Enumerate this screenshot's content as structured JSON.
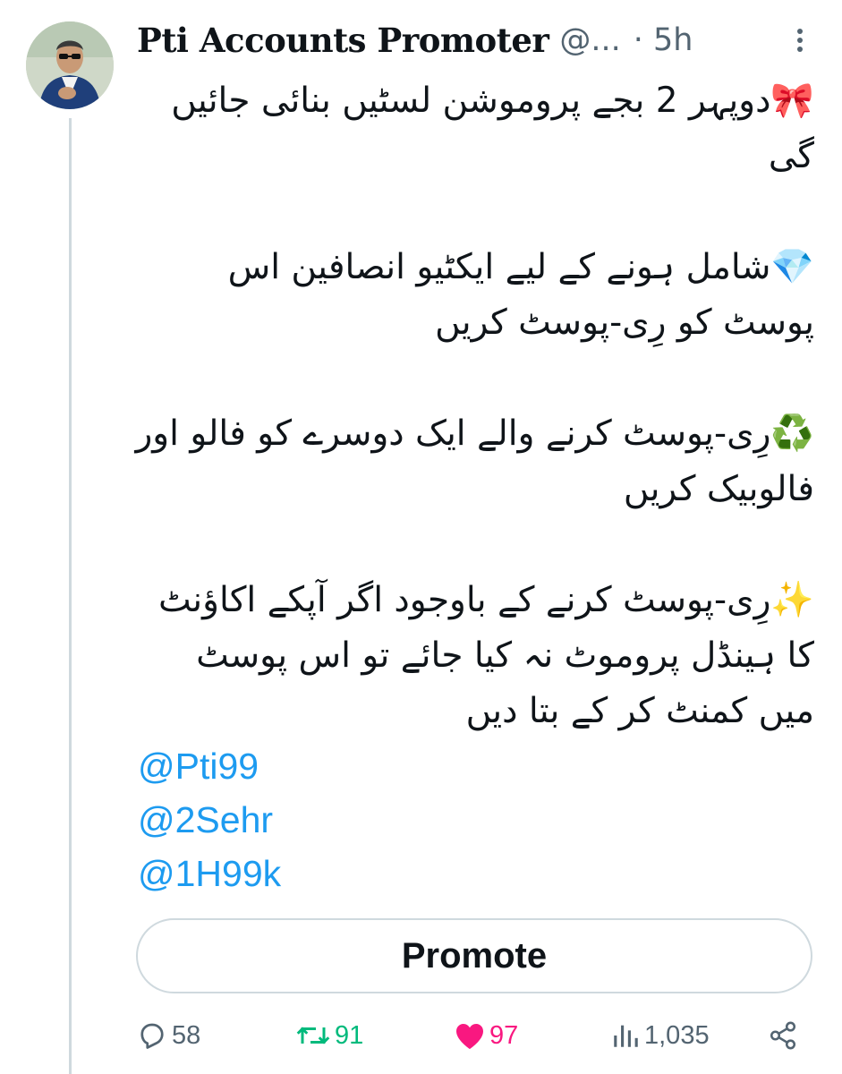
{
  "author": {
    "display_name": "Pti Accounts Promoter",
    "handle": "@...",
    "time": "5h",
    "avatar_icon": "profile-photo"
  },
  "post": {
    "paragraphs": [
      "🎀دوپہر 2 بجے پروموشن لسٹیں بنائی جائیں گی",
      "💎شامل ہونے کے لیے ایکٹیو انصافین اس پوسٹ کو رِی-پوسٹ کریں",
      "♻️رِی-پوسٹ کرنے والے ایک دوسرے کو فالو اور فالوبیک کریں",
      "✨رِی-پوسٹ کرنے کے باوجود اگر آپکے اکاؤنٹ کا ہینڈل پروموٹ نہ کیا جائے تو اس پوسٹ میں کمنٹ کر کے بتا دیں"
    ],
    "mentions": [
      "@Pti99",
      "@2Sehr",
      "@1H99k"
    ]
  },
  "promote_label": "Promote",
  "actions": {
    "replies": "58",
    "reposts": "91",
    "likes": "97",
    "views": "1,035"
  },
  "colors": {
    "link": "#1d9bf0",
    "repost": "#00ba7c",
    "like": "#f91880",
    "muted": "#536471"
  }
}
